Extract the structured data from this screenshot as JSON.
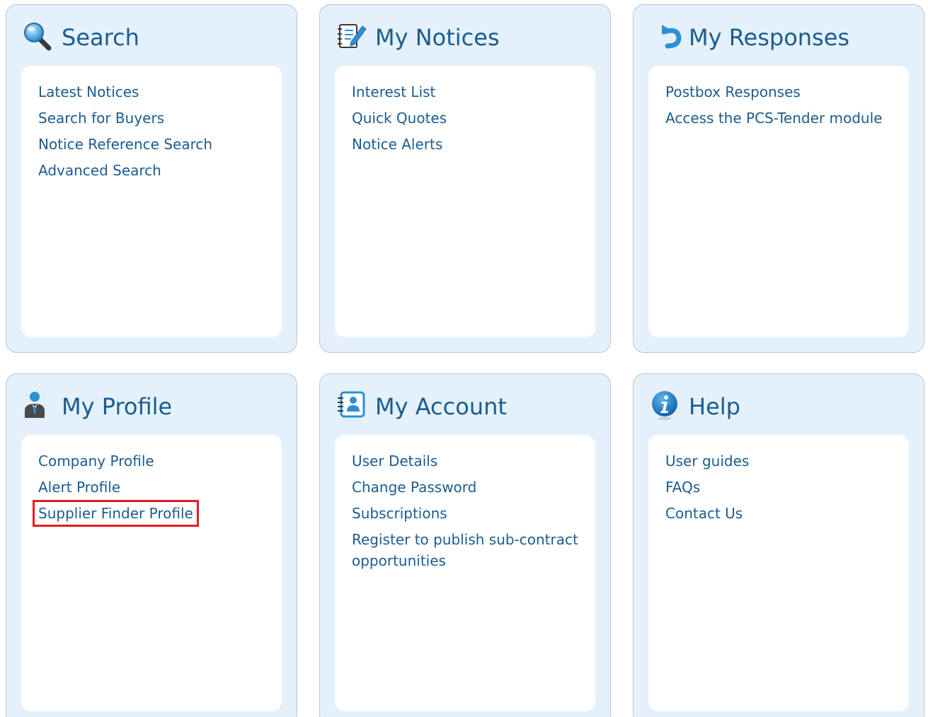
{
  "panels": {
    "search": {
      "title": "Search",
      "icon": "magnifier-icon",
      "links": [
        "Latest Notices",
        "Search for Buyers",
        "Notice Reference Search",
        "Advanced Search"
      ]
    },
    "notices": {
      "title": "My Notices",
      "icon": "notepad-pencil-icon",
      "links": [
        "Interest List",
        "Quick Quotes",
        "Notice Alerts"
      ]
    },
    "responses": {
      "title": "My Responses",
      "icon": "return-arrow-icon",
      "links": [
        "Postbox Responses",
        "Access the PCS-Tender module"
      ]
    },
    "profile": {
      "title": "My Profile",
      "icon": "person-icon",
      "links": [
        "Company Profile",
        "Alert Profile",
        "Supplier Finder Profile"
      ],
      "highlighted_link": "Supplier Finder Profile"
    },
    "account": {
      "title": "My Account",
      "icon": "contact-card-icon",
      "links": [
        "User Details",
        "Change Password",
        "Subscriptions",
        "Register to publish sub-contract opportunities"
      ]
    },
    "help": {
      "title": "Help",
      "icon": "info-icon",
      "links": [
        "User guides",
        "FAQs",
        "Contact Us"
      ]
    }
  },
  "colors": {
    "panel_bg": "#e4f1fb",
    "link": "#1b5c8f",
    "highlight_border": "#e31b23"
  }
}
